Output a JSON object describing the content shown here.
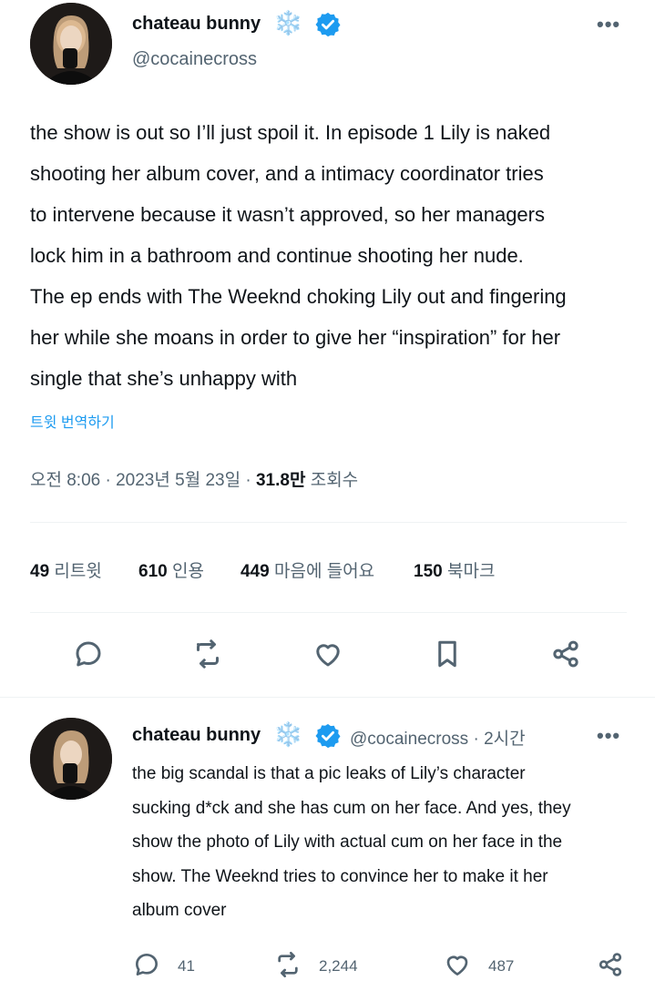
{
  "tweet": {
    "display_name": "chateau bunny",
    "name_emoji": "❄️",
    "handle": "@cocainecross",
    "text": "the show is out so I’ll just spoil it. In episode 1 Lily is naked shooting her album cover, and a intimacy coordinator tries to intervene because it wasn’t approved, so her managers lock him in a bathroom and continue shooting her nude. The ep ends with The Weeknd choking Lily out and fingering her while she moans in order to give her “inspiration” for her single that she’s unhappy with",
    "lines": [
      "the show is out so I’ll just spoil it. In episode 1 Lily is naked",
      "shooting her album cover, and a intimacy coordinator tries",
      "to intervene because it wasn’t approved, so her managers",
      "lock him in a bathroom and continue shooting her nude.",
      "The ep ends with The Weeknd choking Lily out and fingering",
      "her while she moans in order to give her “inspiration” for her",
      "single that she’s unhappy with"
    ],
    "translate_label": "트윗 번역하기",
    "time": "오전 8:06",
    "date": "2023년 5월 23일",
    "views_count": "31.8만",
    "views_label": "조회수",
    "stats": [
      {
        "count": "49",
        "label": "리트윗"
      },
      {
        "count": "610",
        "label": "인용"
      },
      {
        "count": "449",
        "label": "마음에 들어요"
      },
      {
        "count": "150",
        "label": "북마크"
      }
    ]
  },
  "reply": {
    "display_name": "chateau bunny",
    "name_emoji": "❄️",
    "handle": "@cocainecross",
    "age": "2시간",
    "lines": [
      "the big scandal is that a pic leaks of Lily’s character",
      "sucking d*ck and she has cum on her face. And yes, they",
      "show the photo of Lily with actual cum on her face in the",
      "show. The Weeknd tries to convince her to make it her",
      "album cover"
    ],
    "reply_count": "41",
    "retweet_count": "2,244",
    "like_count": "487"
  },
  "colors": {
    "verified": "#1d9bf0",
    "link": "#1d9bf0",
    "icon_gray": "#536471"
  }
}
